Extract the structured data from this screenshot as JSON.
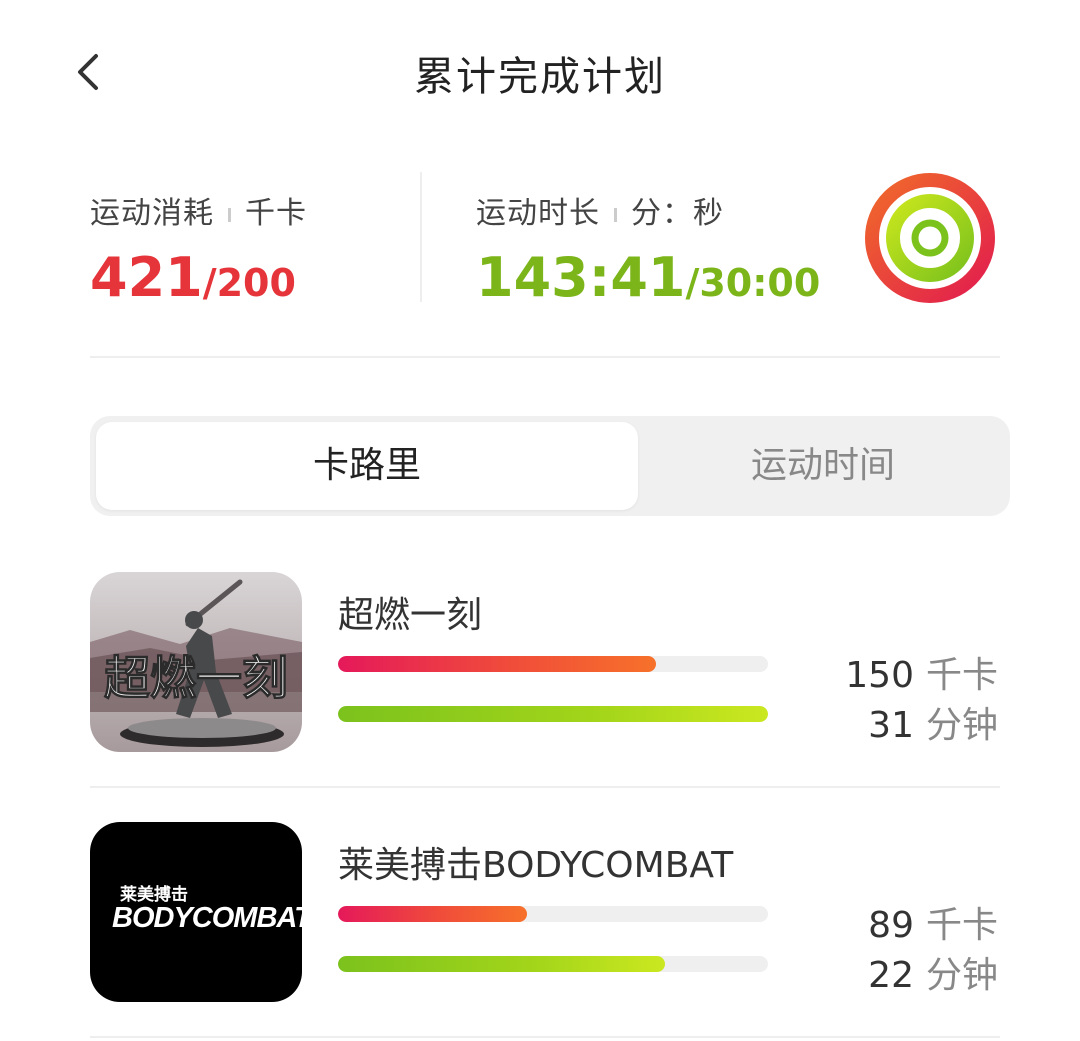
{
  "header": {
    "title": "累计完成计划",
    "back_icon": "chevron-left-icon"
  },
  "summary": {
    "calories": {
      "label": "运动消耗",
      "unit": "千卡",
      "value": "421",
      "goal": "/200",
      "color": "#e5343a"
    },
    "duration": {
      "label": "运动时长",
      "unit": "分：秒",
      "value": "143:41",
      "goal": "/30:00",
      "color": "#7cb51a"
    },
    "rings_icon": "activity-rings-icon"
  },
  "tabs": [
    {
      "label": "卡路里",
      "active": true
    },
    {
      "label": "运动时间",
      "active": false
    }
  ],
  "courses": [
    {
      "title": "超燃一刻",
      "thumbnail_text": "超燃一刻",
      "calories": "150",
      "calories_unit": "千卡",
      "calories_progress": 0.74,
      "minutes": "31",
      "minutes_unit": "分钟",
      "minutes_progress": 1.0
    },
    {
      "title": "莱美搏击BODYCOMBAT",
      "thumbnail_text_cn": "莱美搏击",
      "thumbnail_text_en": "BODYCOMBAT",
      "calories": "89",
      "calories_unit": "千卡",
      "calories_progress": 0.44,
      "minutes": "22",
      "minutes_unit": "分钟",
      "minutes_progress": 0.76
    }
  ]
}
